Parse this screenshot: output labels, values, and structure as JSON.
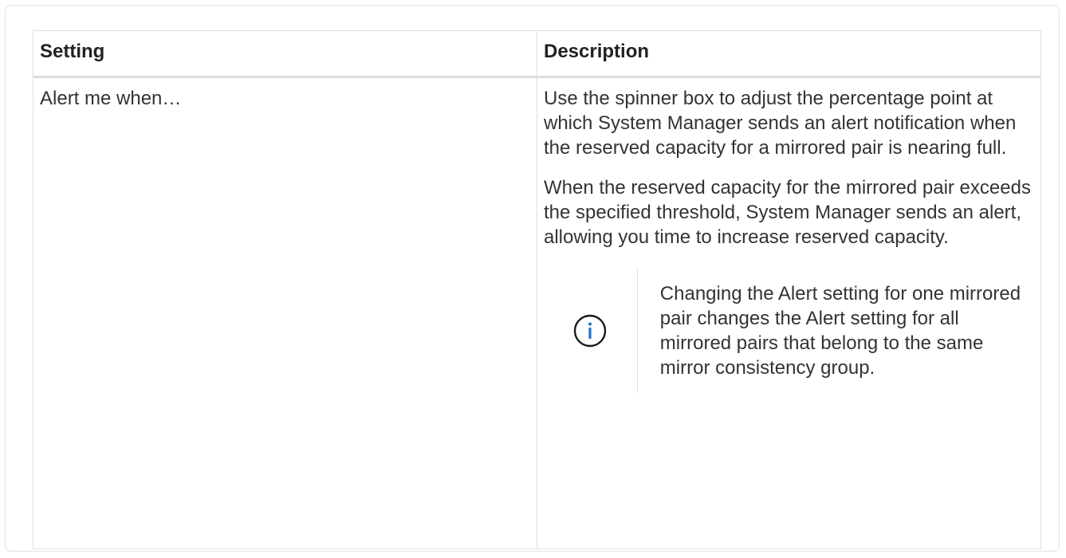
{
  "table": {
    "headers": {
      "setting": "Setting",
      "description": "Description"
    },
    "rows": [
      {
        "setting": "Alert me when…",
        "paragraphs": [
          "Use the spinner box to adjust the percentage point at which System Manager sends an alert notification when the reserved capacity for a mirrored pair is nearing full.",
          "When the reserved capacity for the mirrored pair exceeds the specified threshold, System Manager sends an alert, allowing you time to increase reserved capacity."
        ],
        "note": {
          "icon": "info-icon",
          "text": "Changing the Alert setting for one mirrored pair changes the Alert setting for all mirrored pairs that belong to the same mirror consistency group."
        }
      }
    ]
  },
  "colors": {
    "border": "#dddddd",
    "text": "#333333",
    "icon": "#1a1a1a"
  }
}
